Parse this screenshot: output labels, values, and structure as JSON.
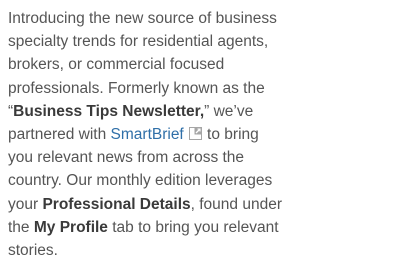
{
  "intro": {
    "lines": [
      "Introducing the new source of business",
      "specialty trends for residential agents,",
      "brokers, or commercial focused",
      "professionals. Formerly known as the"
    ],
    "quote_open": "“",
    "newsletter_name": "Business Tips Newsletter,",
    "quote_close": "” we’ve",
    "partnered_with": "partnered with ",
    "partner_link": "SmartBrief",
    "external_link_icon": "external-link-icon",
    "to_bring": " to bring",
    "lines2": [
      "you relevant news from across the",
      "country. Our monthly edition leverages"
    ],
    "your": "your ",
    "professional_details": "Professional Details",
    "found_under": ", found under",
    "the": "the ",
    "my_profile": "My Profile",
    "tab_text": " tab to bring you relevant",
    "last_line": "stories."
  },
  "colors": {
    "text": "#555555",
    "bold_text": "#3a3a3a",
    "link": "#2f6fa8",
    "icon": "#9a9a9a"
  }
}
